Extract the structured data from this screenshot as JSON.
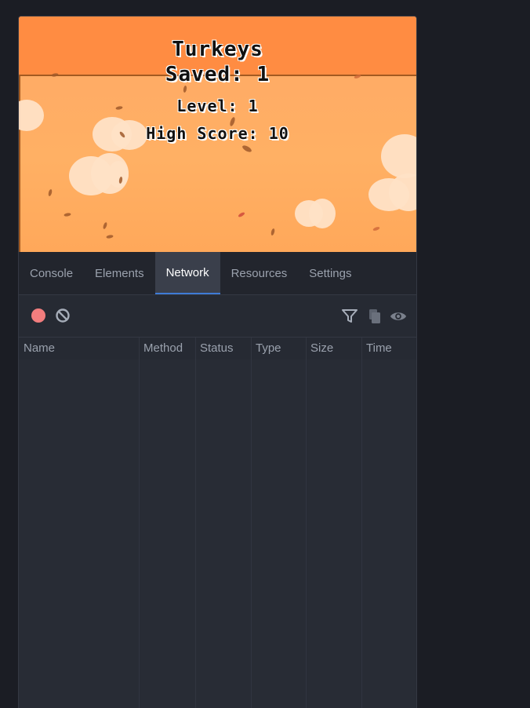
{
  "game": {
    "title_line1": "Turkeys",
    "title_line2": "Saved: 1",
    "level": "Level: 1",
    "high_score": "High Score: 10"
  },
  "tabs": [
    {
      "label": "Console",
      "active": false
    },
    {
      "label": "Elements",
      "active": false
    },
    {
      "label": "Network",
      "active": true
    },
    {
      "label": "Resources",
      "active": false
    },
    {
      "label": "Settings",
      "active": false
    }
  ],
  "toolbar": {
    "record_icon": "record-icon",
    "clear_icon": "clear-icon",
    "filter_icon": "filter-icon",
    "copy_icon": "copy-icon",
    "preserve_icon": "eye-icon"
  },
  "network_table": {
    "columns": [
      "Name",
      "Method",
      "Status",
      "Type",
      "Size",
      "Time"
    ],
    "rows": []
  },
  "colors": {
    "record": "#f27d7e",
    "active_tab_border": "#3e7bd6",
    "game_sky": "#ffb064",
    "game_topbar": "#ff8c42"
  }
}
